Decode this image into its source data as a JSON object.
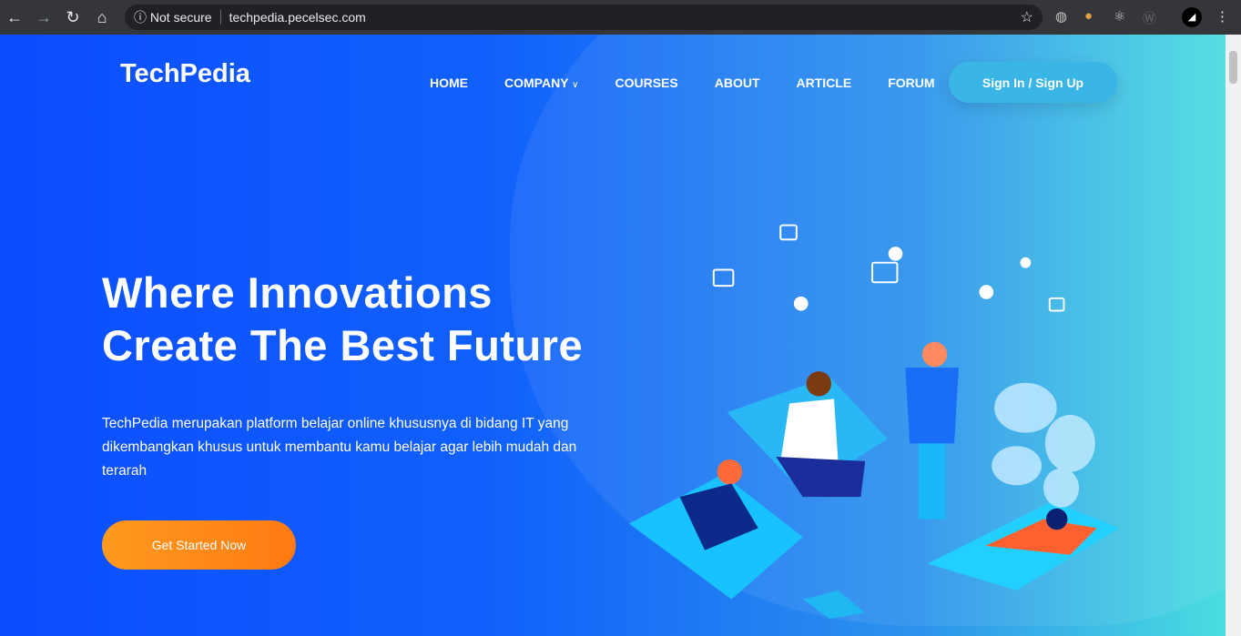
{
  "browser": {
    "security": "Not secure",
    "url": "techpedia.pecelsec.com"
  },
  "site": {
    "logo": "TechPedia",
    "nav": [
      {
        "label": "HOME"
      },
      {
        "label": "COMPANY"
      },
      {
        "label": "COURSES"
      },
      {
        "label": "ABOUT"
      },
      {
        "label": "ARTICLE"
      },
      {
        "label": "FORUM"
      }
    ],
    "signin": "Sign In / Sign Up"
  },
  "hero": {
    "title_line1": "Where Innovations",
    "title_line2": "Create The Best Future",
    "description": "TechPedia merupakan platform belajar online khususnya di bidang IT yang dikembangkan khusus untuk membantu kamu belajar agar lebih mudah dan terarah",
    "cta": "Get Started Now"
  }
}
